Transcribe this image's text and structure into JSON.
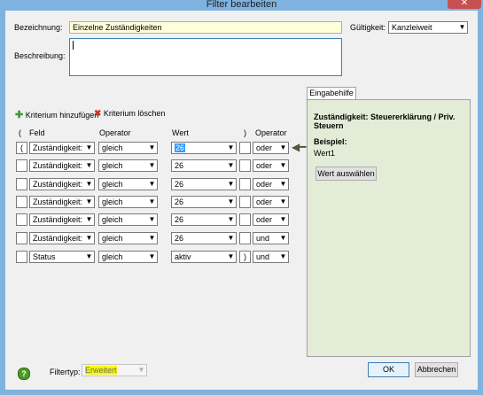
{
  "window": {
    "title": "Filter bearbeiten",
    "close_glyph": "✕"
  },
  "form": {
    "name_label": "Bezeichnung:",
    "name_value": "Einzelne Zuständigkeiten",
    "scope_label": "Gültigkeit:",
    "scope_value": "Kanzleiweit",
    "description_label": "Beschreibung:",
    "description_value": ""
  },
  "toolbar": {
    "add_label": "Kriterium hinzufügen",
    "delete_label": "Kriterium löschen"
  },
  "columns": {
    "open_paren": "(",
    "field": "Feld",
    "operator": "Operator",
    "value": "Wert",
    "close_paren": ")",
    "logic": "Operator"
  },
  "rows": [
    {
      "open": "(",
      "field": "Zuständigkeit:",
      "op": "gleich",
      "value": "26",
      "close": "",
      "logic": "oder"
    },
    {
      "open": "",
      "field": "Zuständigkeit:",
      "op": "gleich",
      "value": "26",
      "close": "",
      "logic": "oder"
    },
    {
      "open": "",
      "field": "Zuständigkeit:",
      "op": "gleich",
      "value": "26",
      "close": "",
      "logic": "oder"
    },
    {
      "open": "",
      "field": "Zuständigkeit:",
      "op": "gleich",
      "value": "26",
      "close": "",
      "logic": "oder"
    },
    {
      "open": "",
      "field": "Zuständigkeit:",
      "op": "gleich",
      "value": "26",
      "close": "",
      "logic": "oder"
    },
    {
      "open": "",
      "field": "Zuständigkeit:",
      "op": "gleich",
      "value": "26",
      "close": "",
      "logic": "und"
    },
    {
      "open": "",
      "field": "Status",
      "op": "gleich",
      "value": "aktiv",
      "close": ")",
      "logic": "und"
    }
  ],
  "help": {
    "tab_label": "Eingabehilfe",
    "heading": "Zuständigkeit: Steuererklärung / Priv. Steuern",
    "example_label": "Beispiel:",
    "example_value": "Wert1",
    "choose_button": "Wert auswählen"
  },
  "footer": {
    "filtertype_label": "Filtertyp:",
    "filtertype_value": "Erweitert",
    "ok_label": "OK",
    "cancel_label": "Abbrechen"
  },
  "colors": {
    "accent": "#3399ff",
    "help_panel": "#e3ecd6",
    "highlight": "#f7f708",
    "titlebar": "#7fb2de"
  }
}
